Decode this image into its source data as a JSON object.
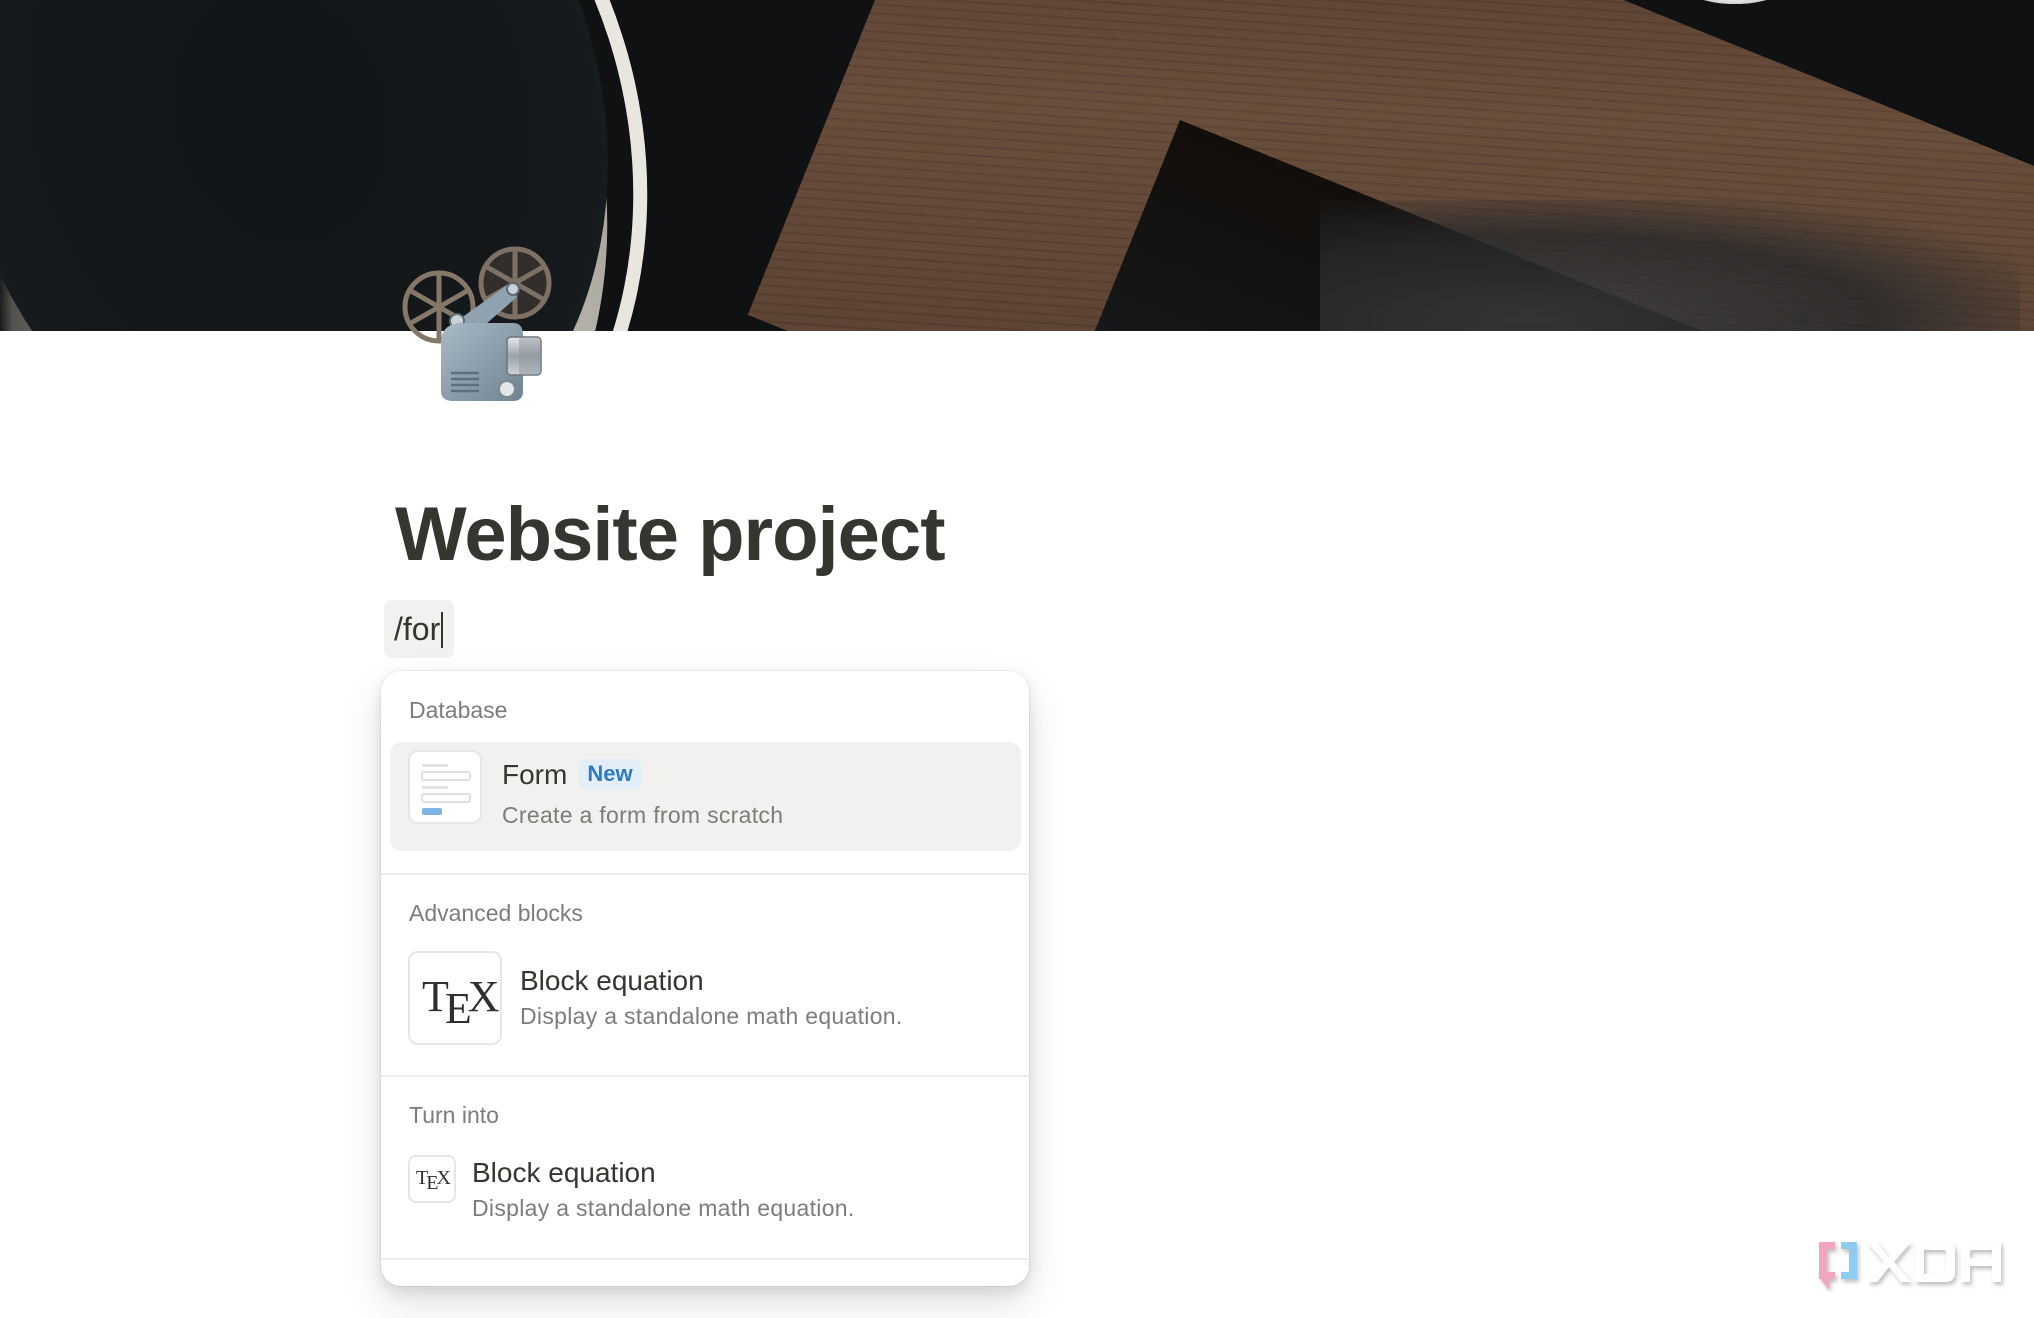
{
  "cover": {
    "description": "Dark photo of a white cup on a wooden table"
  },
  "page": {
    "icon": "film-projector-icon",
    "title": "Website project"
  },
  "command_input": {
    "value": "/for"
  },
  "slash_menu": {
    "sections": [
      {
        "label": "Database",
        "items": [
          {
            "name": "Form",
            "badge": "New",
            "description": "Create a form from scratch",
            "icon": "form-icon",
            "selected": true
          }
        ]
      },
      {
        "label": "Advanced blocks",
        "items": [
          {
            "name": "Block equation",
            "description": "Display a standalone math equation.",
            "icon": "tex-icon",
            "selected": false
          }
        ]
      },
      {
        "label": "Turn into",
        "items": [
          {
            "name": "Block equation",
            "description": "Display a standalone math equation.",
            "icon": "tex-icon",
            "selected": false
          }
        ]
      }
    ],
    "tex_glyph": {
      "t": "T",
      "e": "E",
      "x": "X"
    }
  },
  "colors": {
    "text": "#37352f",
    "muted": "#7d7c78",
    "badge_bg": "#e3eef8",
    "badge_text": "#2b7cc4",
    "selected_bg": "#f1f1f0",
    "form_button": "#7fb2e5"
  },
  "watermark": {
    "text": "XDA"
  }
}
